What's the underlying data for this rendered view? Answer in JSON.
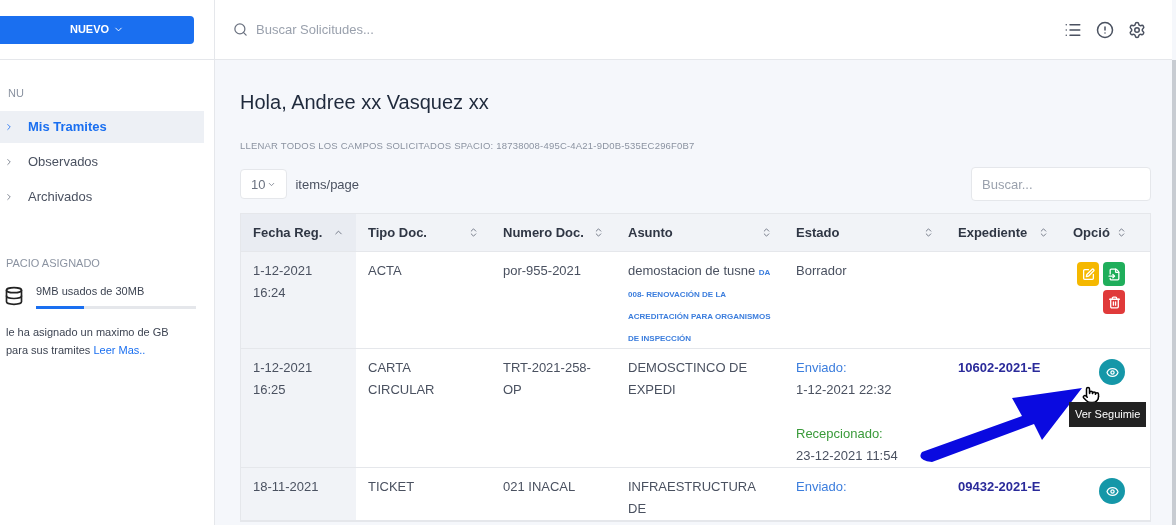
{
  "sidebar": {
    "new_button": "NUEVO",
    "menu_heading": "NU",
    "items": [
      {
        "label": "Mis Tramites",
        "selected": true
      },
      {
        "label": "Observados",
        "selected": false
      },
      {
        "label": "Archivados",
        "selected": false
      }
    ],
    "storage": {
      "heading": "PACIO ASIGNADO",
      "usage": "9MB usados de 30MB",
      "level": 0.3,
      "note": "le ha asignado un maximo de GB para sus tramites",
      "link": "Leer Mas.."
    }
  },
  "topbar": {
    "search_placeholder": "Buscar Solicitudes..."
  },
  "greeting": "Hola, Andree xx Vasquez xx",
  "subtitle": "LLENAR TODOS LOS CAMPOS SOLICITADOS SPACIO: 18738008-495C-4A21-9D0B-535EC296F0B7",
  "page_size": {
    "value": "10",
    "label": "items/page"
  },
  "table_search": {
    "placeholder": "Buscar..."
  },
  "table": {
    "columns": [
      {
        "label": "Fecha Reg.",
        "sorted": true
      },
      {
        "label": "Tipo Doc.",
        "sorted": false
      },
      {
        "label": "Numero Doc.",
        "sorted": false
      },
      {
        "label": "Asunto",
        "sorted": false
      },
      {
        "label": "Estado",
        "sorted": false
      },
      {
        "label": "Expediente",
        "sorted": false
      },
      {
        "label": "Opció",
        "sorted": false
      }
    ],
    "rows": [
      {
        "date": "1-12-2021",
        "time": "16:24",
        "tipo": "ACTA",
        "numero": "por-955-2021",
        "asunto": "demostacion de tusne",
        "asunto_note": "DA 008- RENOVACIÓN DE LA ACREDITACIÓN PARA ORGANISMOS DE INSPECCIÓN",
        "estado": [
          {
            "kind": "plain",
            "label": "Borrador"
          }
        ],
        "actions": [
          {
            "kind": "edit"
          },
          {
            "kind": "export"
          },
          {
            "kind": "delete"
          }
        ]
      },
      {
        "date": "1-12-2021",
        "time": "16:25",
        "tipo": "CARTA CIRCULAR",
        "numero": "TRT-2021-258-OP",
        "asunto": "DEMOSCTINCO DE EXPEDI",
        "estado": [
          {
            "kind": "sent",
            "label": "Enviado:",
            "time": "1-12-2021 22:32"
          },
          {
            "kind": "received",
            "label": "Recepcionado:",
            "time": "23-12-2021 11:54"
          }
        ],
        "expediente": "10602-2021-E",
        "actions": [
          {
            "kind": "view"
          }
        ]
      },
      {
        "date": "18-11-2021",
        "tipo": "TICKET",
        "numero": "021 INACAL",
        "asunto": "INFRAESTRUCTURA DE",
        "estado": [
          {
            "kind": "sent",
            "label": "Enviado:"
          }
        ],
        "expediente": "09432-2021-E",
        "actions": [
          {
            "kind": "view"
          }
        ]
      }
    ]
  },
  "tooltip": "Ver Seguimie"
}
